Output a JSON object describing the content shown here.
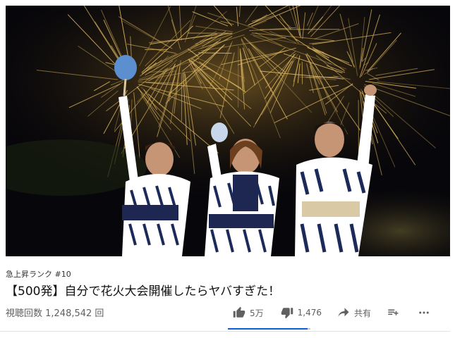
{
  "video": {
    "trending_label": "急上昇ランク #10",
    "title": "【500発】自分で花火大会開催したらヤバすぎた！",
    "views_label": "視聴回数 1,248,542 回"
  },
  "actions": {
    "like_count": "5万",
    "dislike_count": "1,476",
    "share_label": "共有",
    "like_ratio": 0.97
  },
  "icons": {
    "like": "thumbs-up-icon",
    "dislike": "thumbs-down-icon",
    "share": "share-arrow-icon",
    "save": "add-to-playlist-icon",
    "more": "more-dots-icon"
  },
  "colors": {
    "accent": "#065fd4",
    "meta_text": "#606060",
    "firework_gold": "#f2c86a"
  }
}
